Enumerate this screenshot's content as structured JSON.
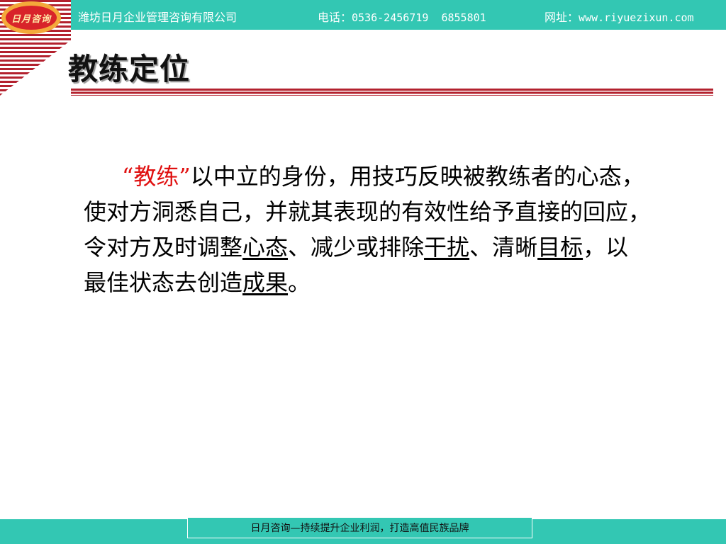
{
  "header": {
    "logo_text": "日月咨询",
    "company": "潍坊日月企业管理咨询有限公司",
    "phone_label": "电话：",
    "phone_numbers": "0536-2456719  6855801",
    "website_label": "网址：",
    "website": "www.riyuezixun.com"
  },
  "slide": {
    "title": "教练定位",
    "body": {
      "term": "“教练”",
      "text_1": "以中立的身份，用技巧反映被教练者的心态，使对方洞悉自己，并就其表现的有效性给予直接的回应，令对方及时调整",
      "underline_1": "心态",
      "text_2": "、减少或排除",
      "underline_2": "干扰",
      "text_3": "、清晰",
      "underline_3": "目标",
      "text_4": "，以最佳状态去创造",
      "underline_4": "成果",
      "text_5": "。"
    }
  },
  "footer": {
    "slogan": "日月咨询—持续提升企业利润，打造高值民族品牌"
  },
  "colors": {
    "header_bar": "#33c7b3",
    "accent_red": "#b3212e",
    "term_red": "#e01010"
  }
}
